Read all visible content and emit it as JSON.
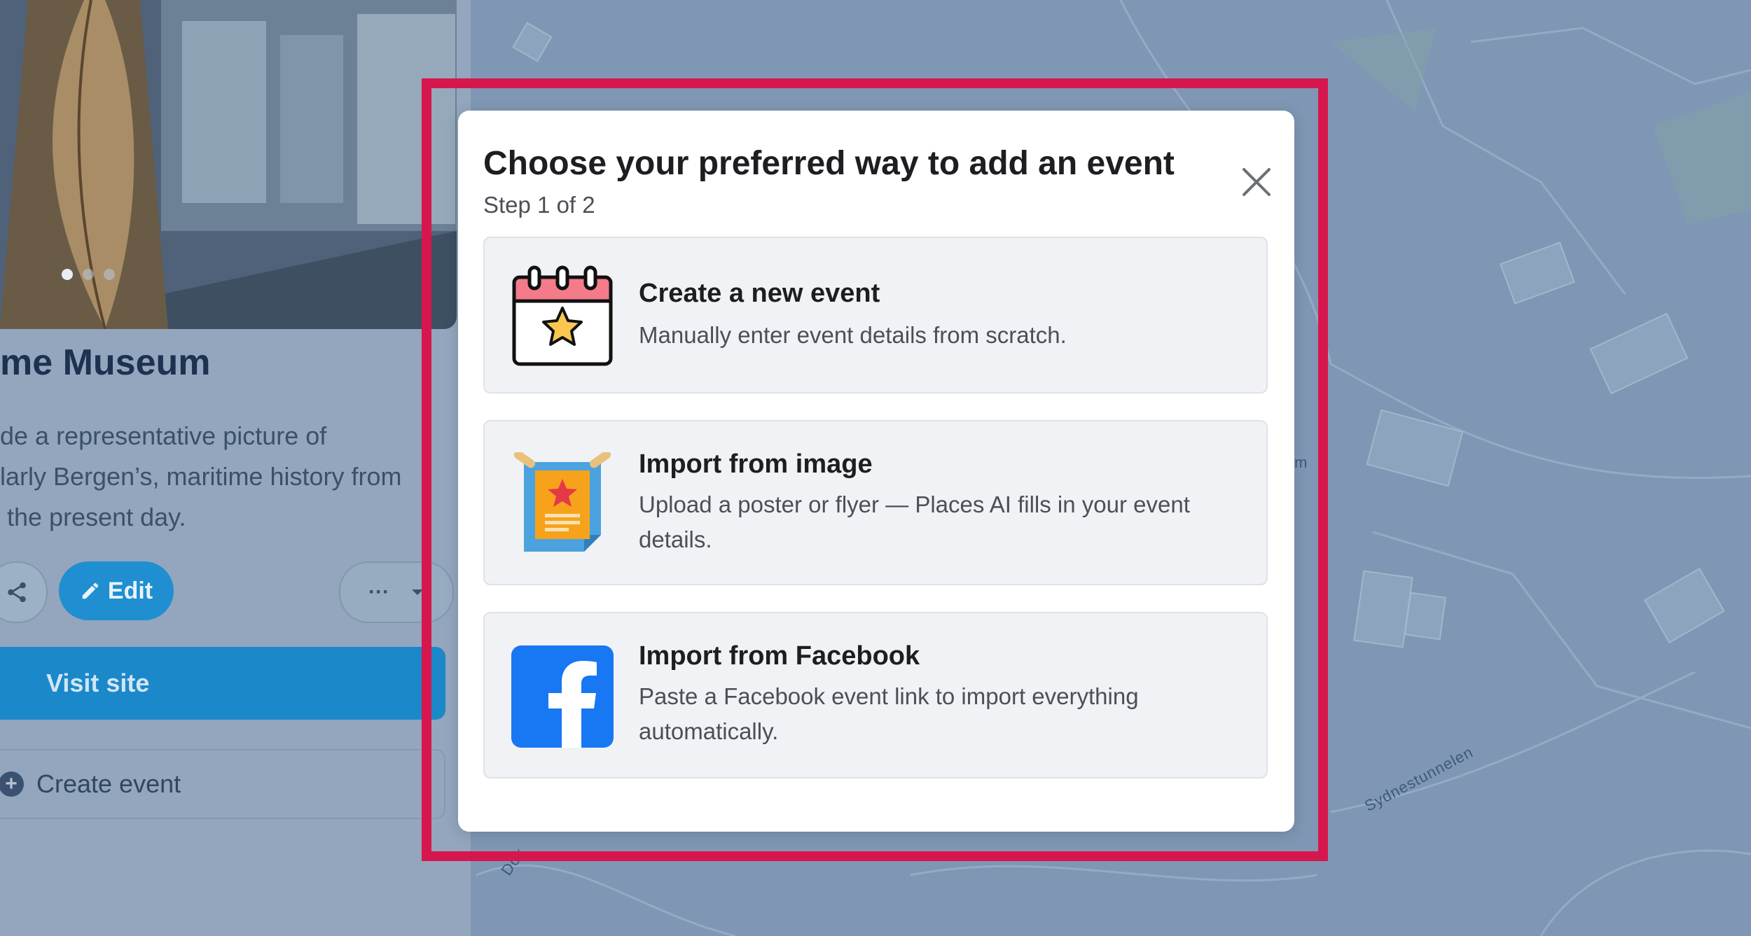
{
  "background": {
    "street_labels": [
      "Sydnestunnelen",
      "Dok",
      "m"
    ]
  },
  "place_panel": {
    "title": "me Museum",
    "description_lines": [
      "de a representative picture of",
      "larly Bergen’s, maritime history from",
      " the present day."
    ],
    "edit_label": "Edit",
    "more_label": "···",
    "visit_label": "Visit site",
    "create_event_label": "Create event",
    "carousel": {
      "count": 3,
      "active": 1
    }
  },
  "modal": {
    "title": "Choose your preferred way to add an event",
    "step": "Step 1 of 2",
    "options": [
      {
        "title": "Create a new event",
        "description": "Manually enter event details from scratch.",
        "icon": "calendar-star-icon"
      },
      {
        "title": "Import from image",
        "description": "Upload a poster or flyer — Places AI fills in your event details.",
        "icon": "poster-icon"
      },
      {
        "title": "Import from Facebook",
        "description": "Paste a Facebook event link to import everything automatically.",
        "icon": "facebook-icon"
      }
    ]
  },
  "colors": {
    "highlight": "#d6174d",
    "accent_blue": "#1f8fd1",
    "facebook_blue": "#1877f2"
  }
}
